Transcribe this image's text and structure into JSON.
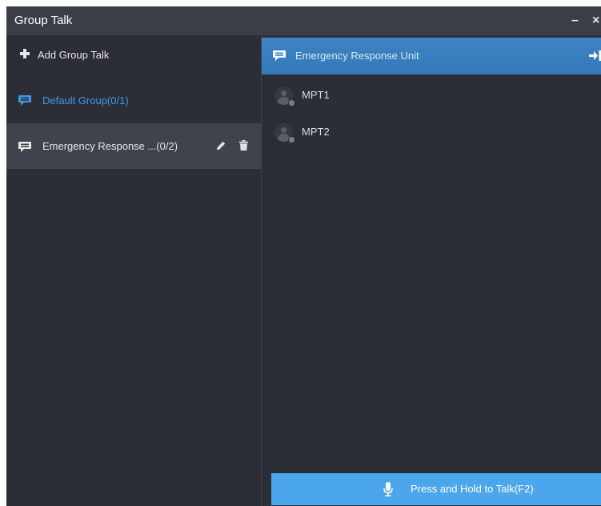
{
  "window": {
    "title": "Group Talk",
    "minimize_glyph": "–",
    "close_glyph": "×"
  },
  "left_panel": {
    "add_label": "Add Group Talk",
    "groups": [
      {
        "label": "Default Group(0/1)",
        "selected": false
      },
      {
        "label": "Emergency Response ...(0/2)",
        "selected": true
      }
    ]
  },
  "right_panel": {
    "header_title": "Emergency Response Unit",
    "members": [
      {
        "name": "MPT1"
      },
      {
        "name": "MPT2"
      }
    ],
    "talk_button_label": "Press and Hold to Talk(F2)"
  },
  "icons": {
    "add": "plus-icon",
    "group": "message-icon",
    "edit": "pencil-icon",
    "delete": "trash-icon",
    "exit": "exit-icon",
    "member": "user-avatar-icon",
    "talk": "microphone-icon"
  },
  "colors": {
    "accent_blue": "#3f9ae6",
    "header_blue": "#3a80c0",
    "talk_button": "#4ba6ec",
    "background": "#2b2e36",
    "titlebar": "#3b3e46",
    "selected_row": "#40434b"
  }
}
